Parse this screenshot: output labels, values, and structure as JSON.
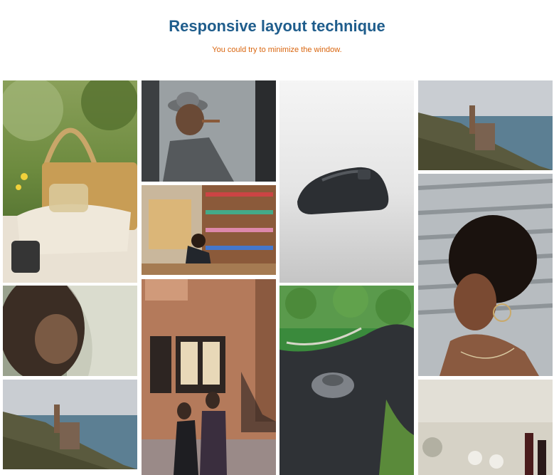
{
  "header": {
    "title": "Responsive layout technique",
    "subtitle": "You could try to minimize the window."
  },
  "gallery": {
    "photos": [
      {
        "icon": "picnic-basket-photo"
      },
      {
        "icon": "man-with-cigar-photo"
      },
      {
        "icon": "bookstore-photo"
      },
      {
        "icon": "computer-mouse-photo"
      },
      {
        "icon": "coastal-ruin-photo"
      },
      {
        "icon": "woman-smiling-photo"
      },
      {
        "icon": "veiled-woman-photo"
      },
      {
        "icon": "couple-on-street-photo"
      },
      {
        "icon": "car-on-road-photo"
      },
      {
        "icon": "coastal-ruin-photo"
      },
      {
        "icon": "dinner-table-photo"
      }
    ]
  },
  "colors": {
    "title": "#1f5d8c",
    "subtitle": "#d9650e"
  }
}
